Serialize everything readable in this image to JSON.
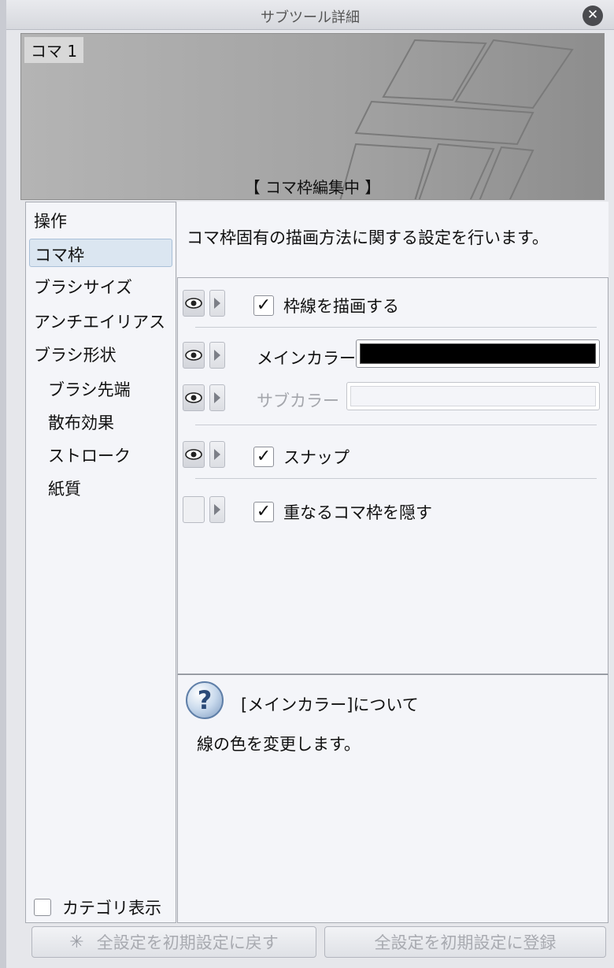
{
  "window": {
    "title": "サブツール詳細"
  },
  "preview": {
    "panel_label": "コマ 1",
    "status": "【 コマ枠編集中 】"
  },
  "sidebar": {
    "items": [
      {
        "label": "操作",
        "indent": false,
        "selected": false
      },
      {
        "label": "コマ枠",
        "indent": false,
        "selected": true
      },
      {
        "label": "ブラシサイズ",
        "indent": false,
        "selected": false
      },
      {
        "label": "アンチエイリアス",
        "indent": false,
        "selected": false
      },
      {
        "label": "ブラシ形状",
        "indent": false,
        "selected": false
      },
      {
        "label": "ブラシ先端",
        "indent": true,
        "selected": false
      },
      {
        "label": "散布効果",
        "indent": true,
        "selected": false
      },
      {
        "label": "ストローク",
        "indent": true,
        "selected": false
      },
      {
        "label": "紙質",
        "indent": true,
        "selected": false
      }
    ],
    "category_toggle_label": "カテゴリ表示"
  },
  "description": "コマ枠固有の描画方法に関する設定を行います。",
  "settings": {
    "draw_border": {
      "label": "枠線を描画する",
      "checked": true,
      "check_mark": "✓"
    },
    "main_color": {
      "label": "メインカラー",
      "value": "#000000"
    },
    "sub_color": {
      "label": "サブカラー",
      "value": "#f4f5f9"
    },
    "snap": {
      "label": "スナップ",
      "checked": true,
      "check_mark": "✓"
    },
    "hide_overlap": {
      "label": "重なるコマ枠を隠す",
      "checked": true,
      "check_mark": "✓"
    }
  },
  "help": {
    "icon_glyph": "?",
    "title": "[メインカラー]について",
    "body": "線の色を変更します。"
  },
  "buttons": {
    "reset_label": "全設定を初期設定に戻す",
    "register_label": "全設定を初期設定に登録"
  }
}
